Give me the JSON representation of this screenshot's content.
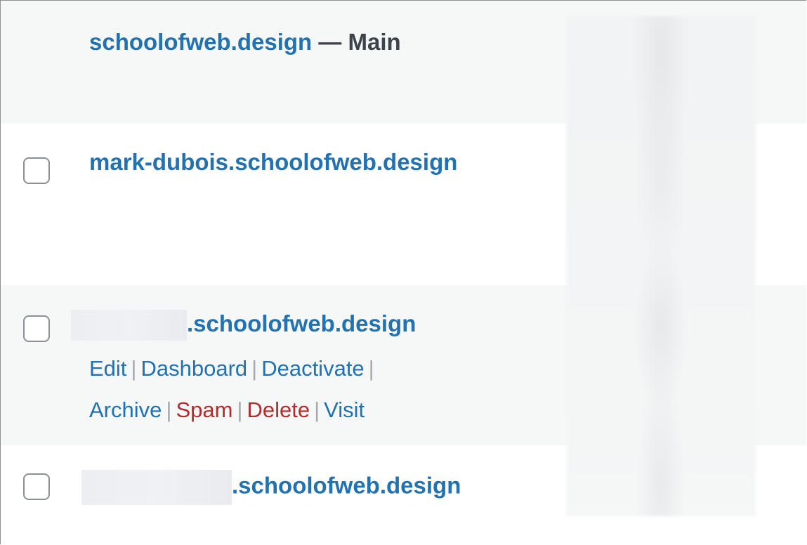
{
  "sites": [
    {
      "domain": "schoolofweb.design",
      "suffix": " — Main",
      "has_checkbox": false
    },
    {
      "domain": "mark-dubois.schoolofweb.design",
      "has_checkbox": true
    },
    {
      "domain_visible": ".schoolofweb.design",
      "domain_redacted": true,
      "has_checkbox": true,
      "actions": [
        {
          "label": "Edit",
          "type": "normal"
        },
        {
          "label": "Dashboard",
          "type": "normal"
        },
        {
          "label": "Deactivate",
          "type": "normal"
        },
        {
          "label": "Archive",
          "type": "normal"
        },
        {
          "label": "Spam",
          "type": "danger"
        },
        {
          "label": "Delete",
          "type": "danger"
        },
        {
          "label": "Visit",
          "type": "normal"
        }
      ],
      "separator": "|"
    },
    {
      "domain_visible": ".schoolofweb.design",
      "domain_redacted": true,
      "has_checkbox": true
    }
  ],
  "colors": {
    "link": "#2271b1",
    "danger": "#b32d2e",
    "alt_row_bg": "#f6f7f7",
    "text": "#3c434a"
  }
}
